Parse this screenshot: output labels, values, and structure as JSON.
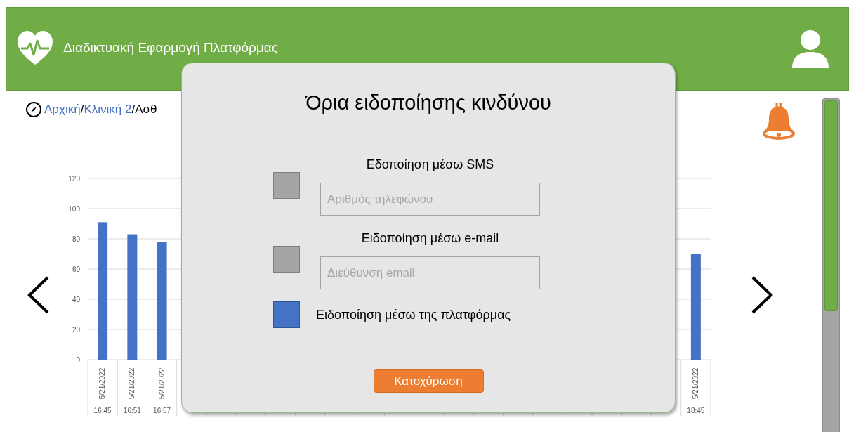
{
  "header": {
    "title": "Διαδικτυακή Εφαρμογή Πλατφόρμας"
  },
  "breadcrumb": [
    {
      "label": "Αρχική",
      "kind": "link"
    },
    {
      "label": "/",
      "kind": "text"
    },
    {
      "label": "Κλινική 2",
      "kind": "link"
    },
    {
      "label": "/Ασθ",
      "kind": "text"
    }
  ],
  "chart_data": {
    "type": "bar",
    "categories": [
      "5/21/2022 16:45",
      "5/21/2022 16:51",
      "5/21/2022 16:57",
      null,
      null,
      null,
      null,
      null,
      null,
      null,
      null,
      null,
      null,
      null,
      null,
      null,
      null,
      null,
      null,
      null,
      "5/21/2022 18:45"
    ],
    "values": [
      91,
      83,
      78,
      null,
      null,
      null,
      null,
      null,
      null,
      null,
      null,
      null,
      null,
      null,
      null,
      null,
      null,
      null,
      null,
      null,
      70
    ],
    "grid": true,
    "ylim": [
      0,
      120
    ],
    "yticks": [
      0,
      20,
      40,
      60,
      80,
      100,
      120
    ]
  },
  "dialog": {
    "title": "Όρια ειδοποίησης κινδύνου",
    "options": [
      {
        "kind": "field",
        "label": "Εδοποίηση μέσω SMS",
        "checked": false,
        "placeholder": "Αριθμός τηλεφώνου"
      },
      {
        "kind": "field",
        "label": "Ειδοποίηση μέσω e-mail",
        "checked": false,
        "placeholder": "Διεύθυνση email"
      },
      {
        "kind": "plain",
        "label": "Ειδοποίηση μέσω της πλατφόρμας",
        "checked": true
      }
    ],
    "save_button": "Κατοχύρωση"
  }
}
